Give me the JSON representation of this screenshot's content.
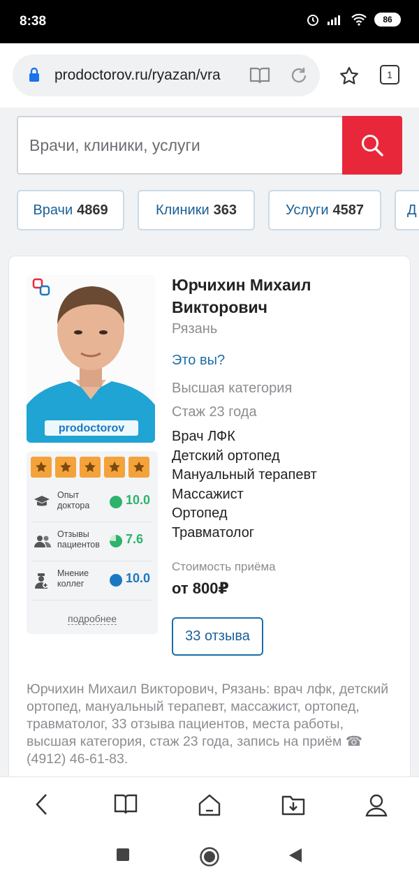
{
  "status": {
    "time": "8:38",
    "battery": "86"
  },
  "browser": {
    "url": "prodoctorov.ru/ryazan/vra",
    "tab_count": "1"
  },
  "search": {
    "placeholder": "Врачи, клиники, услуги"
  },
  "categories": [
    {
      "label": "Врачи",
      "count": "4869"
    },
    {
      "label": "Клиники",
      "count": "363"
    },
    {
      "label": "Услуги",
      "count": "4587"
    },
    {
      "label": "Д",
      "count": ""
    }
  ],
  "doctor": {
    "name": "Юрчихин Михаил Викторович",
    "city": "Рязань",
    "is_you_link": "Это вы?",
    "category": "Высшая категория",
    "experience": "Стаж 23 года",
    "specialties": [
      "Врач ЛФК",
      "Детский ортопед",
      "Мануальный терапевт",
      "Массажист",
      "Ортопед",
      "Травматолог"
    ],
    "price_label": "Стоимость приёма",
    "price": "от 800₽",
    "reviews_button": "33 отзыва",
    "photo_badge": "prodoctorov",
    "description": "Юрчихин Михаил Викторович, Рязань: врач лфк, детский ортопед, мануальный терапевт, массажист, ортопед, травматолог, 33 отзыва пациентов, места работы, высшая категория, стаж 23 года, запись на приём ☎ (4912) 46-61-83."
  },
  "rating": {
    "stars": 5,
    "metrics": [
      {
        "label": "Опыт доктора",
        "value": "10.0",
        "fraction": 1.0,
        "color": "#2db36a"
      },
      {
        "label": "Отзывы пациентов",
        "value": "7.6",
        "fraction": 0.76,
        "color": "#2db36a"
      },
      {
        "label": "Мнение коллег",
        "value": "10.0",
        "fraction": 1.0,
        "color": "#1a78c2"
      }
    ],
    "more_link": "подробнее"
  },
  "colors": {
    "accent_red": "#e8283a",
    "link_blue": "#1a6ea8",
    "star_orange": "#f4a23a"
  }
}
